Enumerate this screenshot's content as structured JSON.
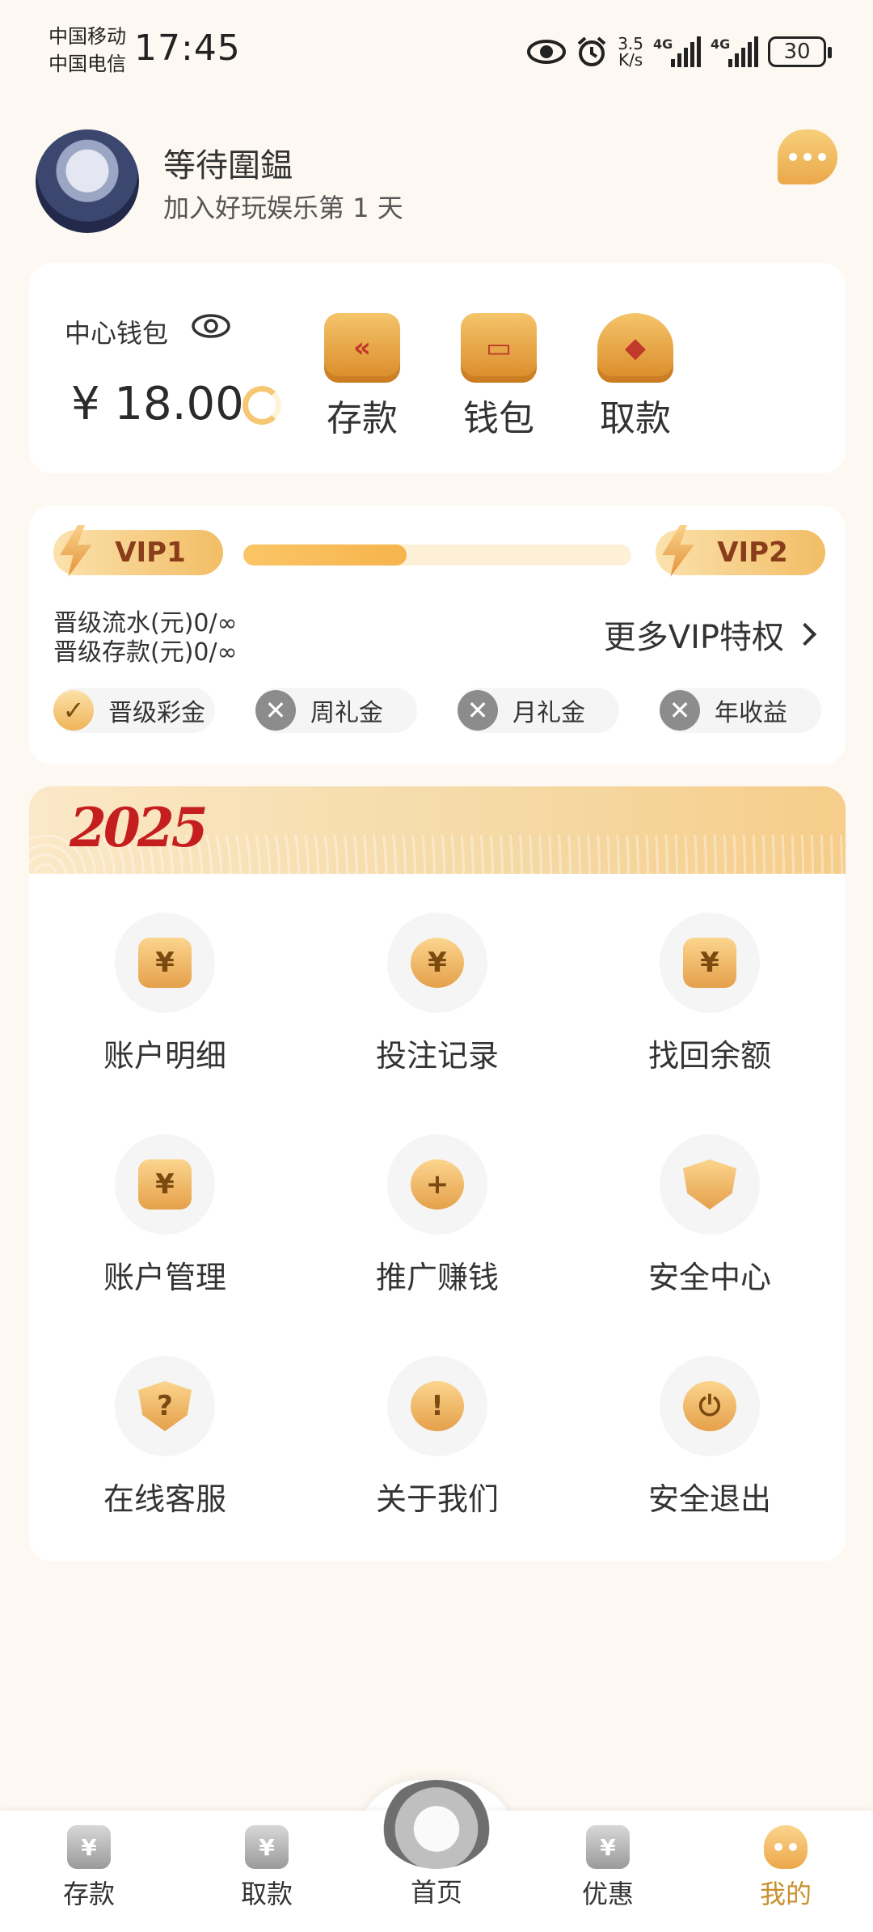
{
  "status_bar": {
    "carrier1": "中国移动",
    "carrier2": "中国电信",
    "time": "17:45",
    "net_speed_value": "3.5",
    "net_speed_unit": "K/s",
    "sim1_label": "4G",
    "sim2_label": "4G",
    "battery": "30"
  },
  "profile": {
    "username": "等待圍鎾",
    "join_text": "加入好玩娱乐第 1 天"
  },
  "wallet": {
    "label": "中心钱包",
    "balance": "¥ 18.00",
    "actions": [
      {
        "label": "存款",
        "icon": "deposit-icon",
        "glyph": "«"
      },
      {
        "label": "钱包",
        "icon": "wallet-icon",
        "glyph": "▭"
      },
      {
        "label": "取款",
        "icon": "withdraw-icon",
        "glyph": "◆"
      }
    ]
  },
  "vip": {
    "current": "VIP1",
    "next": "VIP2",
    "progress": 0.42,
    "flow_req": "晋级流水(元)0/∞",
    "deposit_req": "晋级存款(元)0/∞",
    "more": "更多VIP特权",
    "perks": [
      {
        "label": "晋级彩金",
        "status": "achieved",
        "mark": "✓"
      },
      {
        "label": "周礼金",
        "status": "locked",
        "mark": "✕"
      },
      {
        "label": "月礼金",
        "status": "locked",
        "mark": "✕"
      },
      {
        "label": "年收益",
        "status": "locked",
        "mark": "✕"
      }
    ]
  },
  "banner": {
    "year": "2025"
  },
  "menu": {
    "items": [
      {
        "label": "账户明细",
        "icon": "account-detail-icon",
        "glyph": "¥"
      },
      {
        "label": "投注记录",
        "icon": "bet-record-icon",
        "glyph": "¥"
      },
      {
        "label": "找回余额",
        "icon": "recover-balance-icon",
        "glyph": "¥"
      },
      {
        "label": "账户管理",
        "icon": "account-manage-icon",
        "glyph": "¥"
      },
      {
        "label": "推广赚钱",
        "icon": "promote-icon",
        "glyph": "+"
      },
      {
        "label": "安全中心",
        "icon": "security-shield-icon",
        "glyph": ""
      },
      {
        "label": "在线客服",
        "icon": "help-icon",
        "glyph": "?"
      },
      {
        "label": "关于我们",
        "icon": "about-icon",
        "glyph": "!"
      },
      {
        "label": "安全退出",
        "icon": "power-icon",
        "glyph": "⏻"
      }
    ]
  },
  "bottom_nav": {
    "items": [
      {
        "label": "存款",
        "icon": "deposit-nav-icon",
        "glyph": "¥"
      },
      {
        "label": "取款",
        "icon": "withdraw-nav-icon",
        "glyph": "¥"
      },
      {
        "label": "首页",
        "icon": "home-logo-icon",
        "glyph": ""
      },
      {
        "label": "优惠",
        "icon": "promo-nav-icon",
        "glyph": "¥"
      },
      {
        "label": "我的",
        "icon": "mine-nav-icon",
        "glyph": "••"
      }
    ],
    "active": "我的"
  }
}
